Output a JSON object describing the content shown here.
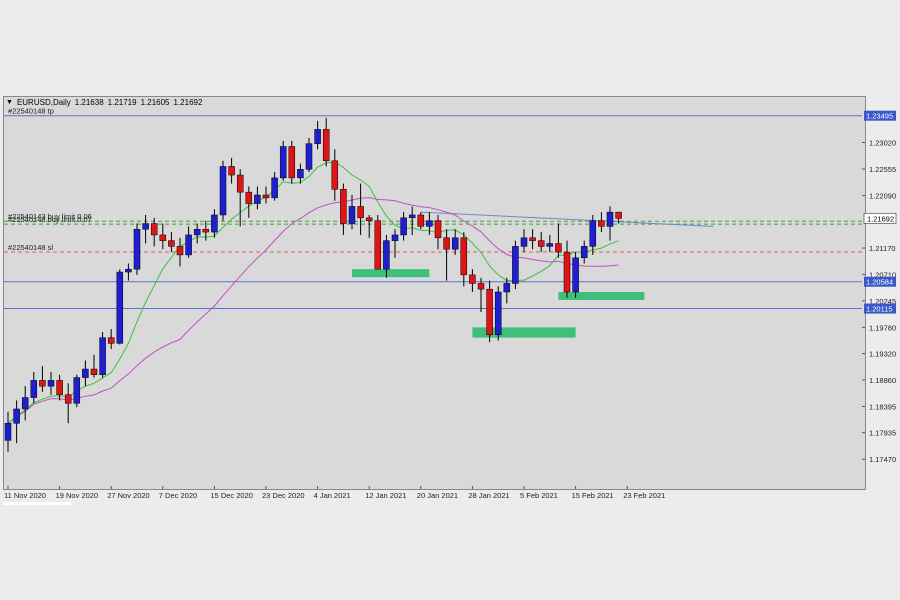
{
  "window": {
    "title": "EURUSD,Daily",
    "ohlc": [
      "1.21638",
      "1.21719",
      "1.21605",
      "1.21692"
    ],
    "collapse_icon": "triangle-down-icon"
  },
  "colors": {
    "background": "#d9d9d9",
    "bull_candle": "#1f1fd1",
    "bear_candle": "#e01414",
    "ma_fast": "#3cc13c",
    "ma_slow": "#c050c8",
    "level_line": "#5a6fd8",
    "trendline": "#6d88c8",
    "zone": "#3ec07a",
    "buy_limit_line": "#3aa53a",
    "sl_line": "#e06060",
    "price_tag": "#3a58c8"
  },
  "chart_data": {
    "type": "candlestick",
    "symbol": "EURUSD",
    "timeframe": "Daily",
    "ylim": [
      1.17,
      1.238
    ],
    "y_ticks": [
      "1.23020",
      "1.22555",
      "1.22090",
      "1.21170",
      "1.20710",
      "1.20245",
      "1.19780",
      "1.19320",
      "1.18860",
      "1.18395",
      "1.17935",
      "1.17470"
    ],
    "x_ticks": [
      {
        "label": "11 Nov 2020",
        "index": 0
      },
      {
        "label": "19 Nov 2020",
        "index": 6
      },
      {
        "label": "27 Nov 2020",
        "index": 12
      },
      {
        "label": "7 Dec 2020",
        "index": 18
      },
      {
        "label": "15 Dec 2020",
        "index": 24
      },
      {
        "label": "23 Dec 2020",
        "index": 30
      },
      {
        "label": "4 Jan 2021",
        "index": 36
      },
      {
        "label": "12 Jan 2021",
        "index": 42
      },
      {
        "label": "20 Jan 2021",
        "index": 48
      },
      {
        "label": "28 Jan 2021",
        "index": 54
      },
      {
        "label": "5 Feb 2021",
        "index": 60
      },
      {
        "label": "15 Feb 2021",
        "index": 66
      },
      {
        "label": "23 Feb 2021",
        "index": 72
      }
    ],
    "candles": [
      {
        "o": 1.178,
        "h": 1.183,
        "l": 1.176,
        "c": 1.181
      },
      {
        "o": 1.181,
        "h": 1.185,
        "l": 1.1775,
        "c": 1.1835
      },
      {
        "o": 1.1835,
        "h": 1.1875,
        "l": 1.1815,
        "c": 1.1855
      },
      {
        "o": 1.1855,
        "h": 1.19,
        "l": 1.1845,
        "c": 1.1885
      },
      {
        "o": 1.1885,
        "h": 1.191,
        "l": 1.1865,
        "c": 1.1875
      },
      {
        "o": 1.1875,
        "h": 1.19,
        "l": 1.186,
        "c": 1.1885
      },
      {
        "o": 1.1885,
        "h": 1.1895,
        "l": 1.185,
        "c": 1.186
      },
      {
        "o": 1.186,
        "h": 1.188,
        "l": 1.181,
        "c": 1.1845
      },
      {
        "o": 1.1845,
        "h": 1.1895,
        "l": 1.1838,
        "c": 1.189
      },
      {
        "o": 1.189,
        "h": 1.192,
        "l": 1.1875,
        "c": 1.1905
      },
      {
        "o": 1.1905,
        "h": 1.193,
        "l": 1.189,
        "c": 1.1895
      },
      {
        "o": 1.1895,
        "h": 1.197,
        "l": 1.189,
        "c": 1.196
      },
      {
        "o": 1.196,
        "h": 1.1975,
        "l": 1.194,
        "c": 1.195
      },
      {
        "o": 1.195,
        "h": 1.208,
        "l": 1.1948,
        "c": 1.2075
      },
      {
        "o": 1.2075,
        "h": 1.209,
        "l": 1.206,
        "c": 1.208
      },
      {
        "o": 1.208,
        "h": 1.216,
        "l": 1.207,
        "c": 1.215
      },
      {
        "o": 1.215,
        "h": 1.2175,
        "l": 1.2125,
        "c": 1.216
      },
      {
        "o": 1.216,
        "h": 1.217,
        "l": 1.212,
        "c": 1.214
      },
      {
        "o": 1.214,
        "h": 1.216,
        "l": 1.2115,
        "c": 1.213
      },
      {
        "o": 1.213,
        "h": 1.2145,
        "l": 1.211,
        "c": 1.212
      },
      {
        "o": 1.212,
        "h": 1.2135,
        "l": 1.2085,
        "c": 1.2105
      },
      {
        "o": 1.2105,
        "h": 1.2155,
        "l": 1.21,
        "c": 1.214
      },
      {
        "o": 1.214,
        "h": 1.216,
        "l": 1.2125,
        "c": 1.215
      },
      {
        "o": 1.215,
        "h": 1.2165,
        "l": 1.213,
        "c": 1.2145
      },
      {
        "o": 1.2145,
        "h": 1.2185,
        "l": 1.2135,
        "c": 1.2175
      },
      {
        "o": 1.2175,
        "h": 1.227,
        "l": 1.2165,
        "c": 1.226
      },
      {
        "o": 1.226,
        "h": 1.2275,
        "l": 1.223,
        "c": 1.2245
      },
      {
        "o": 1.2245,
        "h": 1.2255,
        "l": 1.2155,
        "c": 1.2215
      },
      {
        "o": 1.2215,
        "h": 1.2225,
        "l": 1.217,
        "c": 1.2195
      },
      {
        "o": 1.2195,
        "h": 1.2225,
        "l": 1.2185,
        "c": 1.221
      },
      {
        "o": 1.221,
        "h": 1.2225,
        "l": 1.2195,
        "c": 1.2205
      },
      {
        "o": 1.2205,
        "h": 1.225,
        "l": 1.22,
        "c": 1.224
      },
      {
        "o": 1.224,
        "h": 1.2305,
        "l": 1.2235,
        "c": 1.2295
      },
      {
        "o": 1.2295,
        "h": 1.2305,
        "l": 1.223,
        "c": 1.224
      },
      {
        "o": 1.224,
        "h": 1.2265,
        "l": 1.223,
        "c": 1.2255
      },
      {
        "o": 1.2255,
        "h": 1.231,
        "l": 1.225,
        "c": 1.23
      },
      {
        "o": 1.23,
        "h": 1.234,
        "l": 1.229,
        "c": 1.2325
      },
      {
        "o": 1.2325,
        "h": 1.2345,
        "l": 1.226,
        "c": 1.227
      },
      {
        "o": 1.227,
        "h": 1.229,
        "l": 1.22,
        "c": 1.222
      },
      {
        "o": 1.222,
        "h": 1.223,
        "l": 1.214,
        "c": 1.216
      },
      {
        "o": 1.216,
        "h": 1.221,
        "l": 1.215,
        "c": 1.219
      },
      {
        "o": 1.219,
        "h": 1.223,
        "l": 1.214,
        "c": 1.217
      },
      {
        "o": 1.217,
        "h": 1.2175,
        "l": 1.2135,
        "c": 1.2165
      },
      {
        "o": 1.2165,
        "h": 1.2175,
        "l": 1.2085,
        "c": 1.208
      },
      {
        "o": 1.208,
        "h": 1.214,
        "l": 1.2065,
        "c": 1.213
      },
      {
        "o": 1.213,
        "h": 1.215,
        "l": 1.21,
        "c": 1.214
      },
      {
        "o": 1.214,
        "h": 1.218,
        "l": 1.213,
        "c": 1.217
      },
      {
        "o": 1.217,
        "h": 1.219,
        "l": 1.214,
        "c": 1.2175
      },
      {
        "o": 1.2175,
        "h": 1.218,
        "l": 1.215,
        "c": 1.2155
      },
      {
        "o": 1.2155,
        "h": 1.218,
        "l": 1.214,
        "c": 1.2165
      },
      {
        "o": 1.2165,
        "h": 1.2175,
        "l": 1.2115,
        "c": 1.2135
      },
      {
        "o": 1.2135,
        "h": 1.215,
        "l": 1.206,
        "c": 1.2115
      },
      {
        "o": 1.2115,
        "h": 1.215,
        "l": 1.2105,
        "c": 1.2135
      },
      {
        "o": 1.2135,
        "h": 1.2145,
        "l": 1.205,
        "c": 1.207
      },
      {
        "o": 1.207,
        "h": 1.208,
        "l": 1.204,
        "c": 1.2055
      },
      {
        "o": 1.2055,
        "h": 1.2065,
        "l": 1.2005,
        "c": 1.2045
      },
      {
        "o": 1.2045,
        "h": 1.206,
        "l": 1.1952,
        "c": 1.1965
      },
      {
        "o": 1.1965,
        "h": 1.205,
        "l": 1.1955,
        "c": 1.204
      },
      {
        "o": 1.204,
        "h": 1.2065,
        "l": 1.202,
        "c": 1.2055
      },
      {
        "o": 1.2055,
        "h": 1.213,
        "l": 1.2045,
        "c": 1.212
      },
      {
        "o": 1.212,
        "h": 1.215,
        "l": 1.211,
        "c": 1.2135
      },
      {
        "o": 1.2135,
        "h": 1.215,
        "l": 1.2115,
        "c": 1.213
      },
      {
        "o": 1.213,
        "h": 1.2145,
        "l": 1.211,
        "c": 1.212
      },
      {
        "o": 1.212,
        "h": 1.214,
        "l": 1.211,
        "c": 1.2125
      },
      {
        "o": 1.2125,
        "h": 1.216,
        "l": 1.21,
        "c": 1.211
      },
      {
        "o": 1.211,
        "h": 1.213,
        "l": 1.203,
        "c": 1.204
      },
      {
        "o": 1.204,
        "h": 1.211,
        "l": 1.203,
        "c": 1.21
      },
      {
        "o": 1.21,
        "h": 1.213,
        "l": 1.209,
        "c": 1.212
      },
      {
        "o": 1.212,
        "h": 1.2175,
        "l": 1.2105,
        "c": 1.2165
      },
      {
        "o": 1.2165,
        "h": 1.218,
        "l": 1.2145,
        "c": 1.2155
      },
      {
        "o": 1.2155,
        "h": 1.219,
        "l": 1.213,
        "c": 1.218
      },
      {
        "o": 1.218,
        "h": 1.2175,
        "l": 1.216,
        "c": 1.2169
      }
    ],
    "overlays": {
      "ma_fast_period": 8,
      "ma_slow_period": 21
    },
    "levels": [
      {
        "price": 1.2349,
        "style": "solid",
        "color": "#5a6fd8",
        "label": "#22540148 tp",
        "tag": "1.23495"
      },
      {
        "price": 1.2164,
        "style": "dashed",
        "color": "#3aa53a",
        "label": "#22540143 buy limit 0.06",
        "tag": ""
      },
      {
        "price": 1.2159,
        "style": "dashed",
        "color": "#3aa53a",
        "label": "#22540148 buy limit 0.07",
        "tag": ""
      },
      {
        "price": 1.211,
        "style": "dashed",
        "color": "#e06060",
        "label": "#22540148 sl",
        "tag": ""
      },
      {
        "price": 1.2058,
        "style": "solid",
        "color": "#5a6fd8",
        "label": "",
        "tag": "1.20584"
      },
      {
        "price": 1.2011,
        "style": "solid",
        "color": "#5a6fd8",
        "label": "",
        "tag": "1.20115"
      }
    ],
    "current_price": "1.21692",
    "trendline": {
      "x0": 48,
      "y0": 1.218,
      "x1": 82,
      "y1": 1.2155
    },
    "zones": [
      {
        "x0": 40,
        "x1": 49,
        "y0": 1.2066,
        "y1": 1.208
      },
      {
        "x0": 54,
        "x1": 66,
        "y0": 1.196,
        "y1": 1.1978
      },
      {
        "x0": 64,
        "x1": 74,
        "y0": 1.2026,
        "y1": 1.204
      }
    ]
  }
}
